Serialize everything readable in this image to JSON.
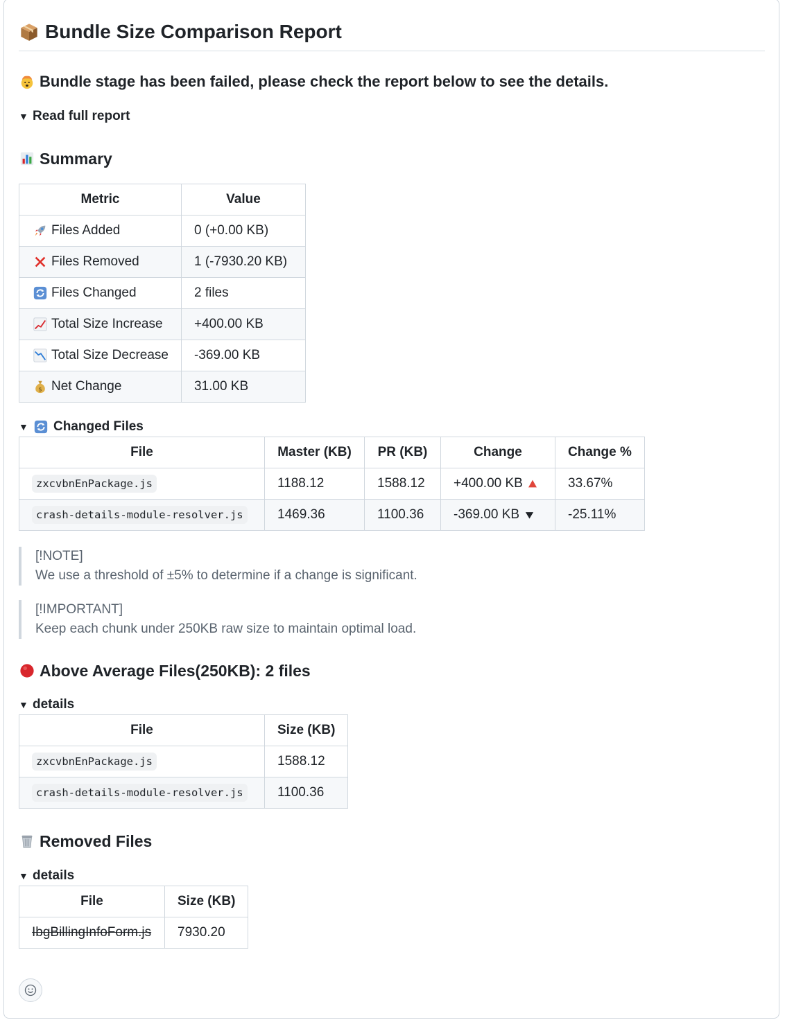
{
  "report": {
    "title": "Bundle Size Comparison Report",
    "status_message": "Bundle stage has been failed, please check the report below to see the details.",
    "full_report_toggle": "Read full report"
  },
  "summary": {
    "heading": "Summary",
    "columns": [
      "Metric",
      "Value"
    ],
    "rows": [
      {
        "icon": "rocket-icon",
        "metric": "Files Added",
        "value": "0 (+0.00 KB)"
      },
      {
        "icon": "cross-mark-icon",
        "metric": "Files Removed",
        "value": "1 (-7930.20 KB)"
      },
      {
        "icon": "refresh-icon",
        "metric": "Files Changed",
        "value": "2 files"
      },
      {
        "icon": "chart-increasing-icon",
        "metric": "Total Size Increase",
        "value": "+400.00 KB"
      },
      {
        "icon": "chart-decreasing-icon",
        "metric": "Total Size Decrease",
        "value": "-369.00 KB"
      },
      {
        "icon": "money-bag-icon",
        "metric": "Net Change",
        "value": "31.00 KB"
      }
    ]
  },
  "changed_files": {
    "toggle_label": "Changed Files",
    "columns": [
      "File",
      "Master (KB)",
      "PR (KB)",
      "Change",
      "Change %"
    ],
    "rows": [
      {
        "file": "zxcvbnEnPackage.js",
        "master": "1188.12",
        "pr": "1588.12",
        "change": "+400.00 KB",
        "change_icon": "red-triangle-up-icon",
        "change_pct": "33.67%"
      },
      {
        "file": "crash-details-module-resolver.js",
        "master": "1469.36",
        "pr": "1100.36",
        "change": "-369.00 KB",
        "change_icon": "triangle-down-icon",
        "change_pct": "-25.11%"
      }
    ]
  },
  "notes": [
    {
      "tag": "[!NOTE]",
      "text": "We use a threshold of ±5% to determine if a change is significant."
    },
    {
      "tag": "[!IMPORTANT]",
      "text": "Keep each chunk under 250KB raw size to maintain optimal load."
    }
  ],
  "above_average": {
    "heading": "Above Average Files(250KB): 2 files",
    "toggle_label": "details",
    "columns": [
      "File",
      "Size (KB)"
    ],
    "rows": [
      {
        "file": "zxcvbnEnPackage.js",
        "size": "1588.12"
      },
      {
        "file": "crash-details-module-resolver.js",
        "size": "1100.36"
      }
    ]
  },
  "removed_files": {
    "heading": "Removed Files",
    "toggle_label": "details",
    "columns": [
      "File",
      "Size (KB)"
    ],
    "rows": [
      {
        "file": "IbgBillingInfoForm.js",
        "size": "7930.20"
      }
    ]
  },
  "icons": {
    "title": "package-icon",
    "status": "exploding-head-icon",
    "summary": "bar-chart-icon",
    "changed_files": "refresh-icon",
    "above_average": "red-circle-icon",
    "removed_files": "wastebasket-icon",
    "reaction": "smiley-icon"
  },
  "colors": {
    "border": "#d0d7de",
    "stripe": "#f6f8fa",
    "quote_text": "#59636e",
    "increase": "#e0453a",
    "red_circle": "#d8262c"
  }
}
